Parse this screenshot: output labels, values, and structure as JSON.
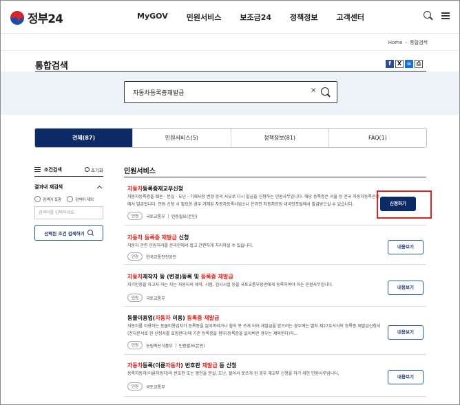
{
  "header": {
    "logo_text": "정부24",
    "nav": [
      "MyGOV",
      "민원서비스",
      "보조금24",
      "정책정보",
      "고객센터"
    ],
    "icons": [
      "search-icon",
      "menu-icon"
    ]
  },
  "breadcrumb": {
    "home": "Home",
    "current": "통합검색"
  },
  "page_title": "통합검색",
  "share": {
    "facebook": "f",
    "x": "X",
    "link": "🔗",
    "print": "🖶"
  },
  "search": {
    "query": "자동차등록증재발급",
    "clear": "×"
  },
  "tabs": [
    {
      "label": "전체(87)",
      "active": true
    },
    {
      "label": "민원서비스(5)",
      "active": false
    },
    {
      "label": "정책정보(81)",
      "active": false
    },
    {
      "label": "FAQ(1)",
      "active": false
    }
  ],
  "sidebar": {
    "condition_label": "조건검색",
    "reset_label": "초기화",
    "in_result_label": "결과내 재검색",
    "radio_include": "검색어 포함",
    "radio_exclude": "검색어 제외",
    "input_placeholder": "검색어를 입력하세요.",
    "search_button": "선택된 조건 검색하기"
  },
  "section_title": "민원서비스",
  "results": [
    {
      "title_parts": [
        {
          "t": "자동차",
          "hl": true
        },
        {
          "t": "등록증재교부신청",
          "hl": false
        }
      ],
      "desc": "자동차등록증을 훼손 · 분실 · 도난 · 기재사항 변경 등의 사유로 다시 발급을 신청하는 민원사무입니다. 해당 등록증은 서울 등 전국 자동차등록관청에서 발급됩니다. 민원 신청 시 필요한 경우 거래된 자동차등록사업소나 온라인 자동차민원 대국민포털에서 발급받으실 수 있습니다.",
      "badge": "민원",
      "orgs": [
        "국토교통부",
        "인증필요(본인)"
      ],
      "button": "신청하기",
      "button_style": "solid"
    },
    {
      "title_parts": [
        {
          "t": "자동차 등록증 재발급",
          "hl": true
        },
        {
          "t": " 신청",
          "hl": false
        }
      ],
      "desc": "자동차 관련 민원처리를 온라인에서 접고 간편하게 처리하실 수 있습니다.",
      "badge": "민원",
      "orgs": [
        "한국교통안전공단"
      ],
      "button": "내용보기",
      "button_style": "outline"
    },
    {
      "title_parts": [
        {
          "t": "자동차",
          "hl": true
        },
        {
          "t": "제작자 등 (변경)등록 및 ",
          "hl": false
        },
        {
          "t": "등록증 재발급",
          "hl": true
        }
      ],
      "desc": "자기인증을 하고자 하는 자는 자동차의 제작, 시험, 검사시설 등을 국토교통부장관에게 등록하여야 하는 민원사무입니다.",
      "badge": "민원",
      "orgs": [
        "국토교통부"
      ],
      "button": "내용보기",
      "button_style": "outline"
    },
    {
      "title_parts": [
        {
          "t": "동물이용업(",
          "hl": false
        },
        {
          "t": "자동차",
          "hl": true
        },
        {
          "t": " 이용) ",
          "hl": false
        },
        {
          "t": "등록증 재발급",
          "hl": true
        }
      ],
      "desc": "자동차를 이용하는 동물미용업자가 등록증을 잃어버리거나 헐어 못 쓰게 되어 재발급을 받으려는 경우에는 별지 제27호서식의 등록증 재발급신청서(전자문서로 된 신청서를 포함한다)에 기존 등록증을 첨부(등록증을 잃어버린 경우는 제외한다)하...",
      "badge": "민원",
      "orgs": [
        "농림축산식품부",
        "인증필요(본인)"
      ],
      "button": "내용보기",
      "button_style": "outline"
    },
    {
      "title_parts": [
        {
          "t": "자동차",
          "hl": true
        },
        {
          "t": "등록(이륜",
          "hl": false
        },
        {
          "t": "자동차",
          "hl": true
        },
        {
          "t": ") 번호판 ",
          "hl": false
        },
        {
          "t": "재발급",
          "hl": true
        },
        {
          "t": " 등 신청",
          "hl": false
        }
      ],
      "desc": "등록자동차(이륜자동차)의 번호판 또는 봉인을 분실, 도난, 헐어서 못쓰게 된 경우 재교부 신청을 하기 위한 민원사무입니다.",
      "badge": "민원",
      "orgs": [
        "국토교통부"
      ],
      "button": "내용보기",
      "button_style": "outline"
    }
  ]
}
